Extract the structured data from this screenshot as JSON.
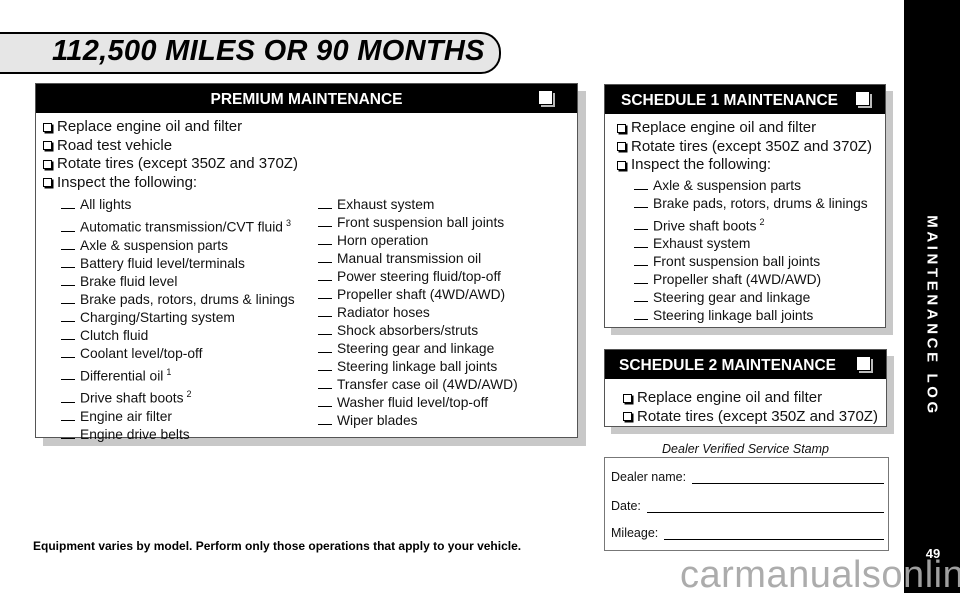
{
  "title_banner": "112,500 MILES OR 90 MONTHS",
  "premium": {
    "title": "PREMIUM MAINTENANCE",
    "tasks": [
      "Replace engine oil and filter",
      "Road test vehicle",
      "Rotate tires (except 350Z and 370Z)",
      "Inspect the following:"
    ],
    "inspect_left": [
      {
        "label": "All lights",
        "sup": ""
      },
      {
        "label": "Automatic transmission/CVT fluid",
        "sup": "3"
      },
      {
        "label": "Axle & suspension parts",
        "sup": ""
      },
      {
        "label": "Battery fluid level/terminals",
        "sup": ""
      },
      {
        "label": "Brake fluid level",
        "sup": ""
      },
      {
        "label": "Brake pads, rotors, drums & linings",
        "sup": ""
      },
      {
        "label": "Charging/Starting system",
        "sup": ""
      },
      {
        "label": "Clutch fluid",
        "sup": ""
      },
      {
        "label": "Coolant level/top-off",
        "sup": ""
      },
      {
        "label": "Differential oil",
        "sup": "1"
      },
      {
        "label": "Drive shaft boots",
        "sup": "2"
      },
      {
        "label": "Engine air filter",
        "sup": ""
      },
      {
        "label": "Engine drive belts",
        "sup": ""
      }
    ],
    "inspect_right": [
      {
        "label": "Exhaust system",
        "sup": ""
      },
      {
        "label": "Front suspension ball joints",
        "sup": ""
      },
      {
        "label": "Horn operation",
        "sup": ""
      },
      {
        "label": "Manual transmission oil",
        "sup": ""
      },
      {
        "label": "Power steering fluid/top-off",
        "sup": ""
      },
      {
        "label": "Propeller shaft (4WD/AWD)",
        "sup": ""
      },
      {
        "label": "Radiator hoses",
        "sup": ""
      },
      {
        "label": "Shock absorbers/struts",
        "sup": ""
      },
      {
        "label": "Steering gear and linkage",
        "sup": ""
      },
      {
        "label": "Steering linkage ball joints",
        "sup": ""
      },
      {
        "label": "Transfer case oil (4WD/AWD)",
        "sup": ""
      },
      {
        "label": "Washer fluid level/top-off",
        "sup": ""
      },
      {
        "label": "Wiper blades",
        "sup": ""
      }
    ]
  },
  "schedule1": {
    "title": "SCHEDULE 1 MAINTENANCE",
    "tasks": [
      "Replace engine oil and filter",
      "Rotate tires (except 350Z and 370Z)",
      "Inspect the following:"
    ],
    "inspect": [
      {
        "label": "Axle & suspension parts",
        "sup": ""
      },
      {
        "label": "Brake pads, rotors, drums & linings",
        "sup": ""
      },
      {
        "label": "Drive shaft boots",
        "sup": "2"
      },
      {
        "label": "Exhaust system",
        "sup": ""
      },
      {
        "label": "Front suspension ball joints",
        "sup": ""
      },
      {
        "label": "Propeller shaft (4WD/AWD)",
        "sup": ""
      },
      {
        "label": "Steering gear and linkage",
        "sup": ""
      },
      {
        "label": "Steering linkage ball joints",
        "sup": ""
      }
    ]
  },
  "schedule2": {
    "title": "SCHEDULE 2 MAINTENANCE",
    "tasks": [
      "Replace engine oil and filter",
      "Rotate tires (except 350Z and 370Z)"
    ]
  },
  "stamp": {
    "title": "Dealer Verified Service Stamp",
    "fields": [
      {
        "label": "Dealer name:",
        "value": ""
      },
      {
        "label": "Date:",
        "value": ""
      },
      {
        "label": "Mileage:",
        "value": ""
      }
    ]
  },
  "footnote": "Equipment varies by model. Perform only those operations that apply to your vehicle.",
  "side_tab": {
    "label": "MAINTENANCE LOG",
    "page_number": "49"
  },
  "watermark": "carmanualsonline.info"
}
